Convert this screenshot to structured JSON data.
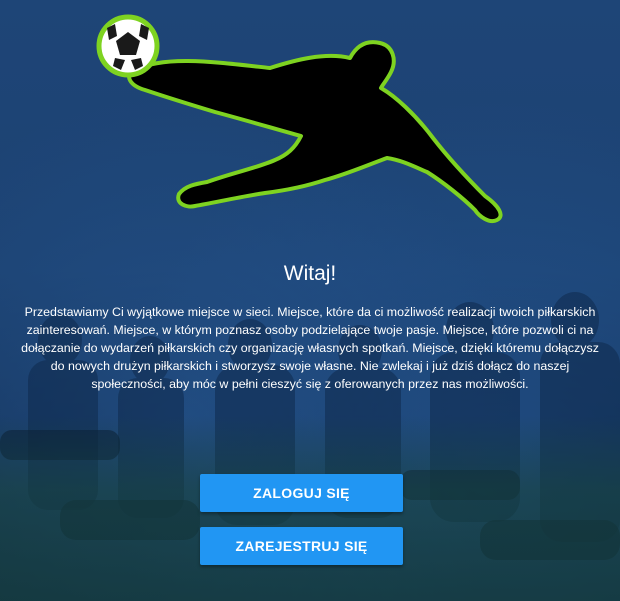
{
  "colors": {
    "primary_button": "#2196f3",
    "logo_outline": "#7ed321",
    "background_overlay": "#1c4272"
  },
  "logo": {
    "icon": "soccer-player-kick-icon",
    "ball_icon": "soccer-ball-icon"
  },
  "welcome": {
    "title": "Witaj!",
    "description": "Przedstawiamy Ci wyjątkowe miejsce w sieci. Miejsce, które da ci możliwość realizacji twoich piłkarskich zainteresowań. Miejsce, w którym poznasz osoby podzielające twoje pasje. Miejsce, które pozwoli ci na dołączanie do wydarzeń piłkarskich czy organizację własnych spotkań. Miejsce, dzięki któremu dołączysz do nowych drużyn piłkarskich i stworzysz swoje własne. Nie zwlekaj i już dziś dołącz do naszej społeczności, aby móc w pełni cieszyć się z oferowanych przez nas możliwości."
  },
  "actions": {
    "login_label": "ZALOGUJ SIĘ",
    "register_label": "ZAREJESTRUJ SIĘ"
  }
}
